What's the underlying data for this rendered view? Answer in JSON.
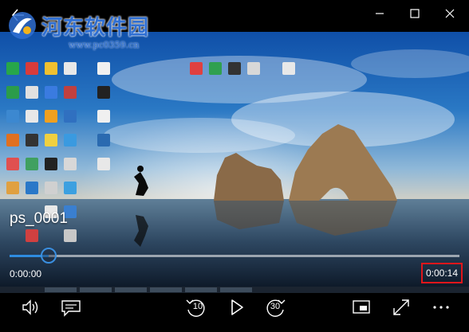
{
  "watermark": {
    "name": "河东软件园",
    "url": "www.pc0359.cn"
  },
  "player": {
    "file_title": "ps_0001",
    "current_time": "0:00:00",
    "total_time": "0:00:14",
    "progress": 0.087
  },
  "controls": {
    "skip_back_seconds": "10",
    "skip_forward_seconds": "30"
  },
  "colors": {
    "accent": "#2e8ce0",
    "highlight_box": "#e0161b",
    "watermark": "#2f6fd3"
  },
  "icons": [
    "back-arrow-icon",
    "minimize-icon",
    "maximize-icon",
    "close-icon",
    "volume-icon",
    "captions-icon",
    "skip-back-icon",
    "play-icon",
    "skip-forward-icon",
    "mini-view-icon",
    "fullscreen-icon",
    "more-icon"
  ]
}
